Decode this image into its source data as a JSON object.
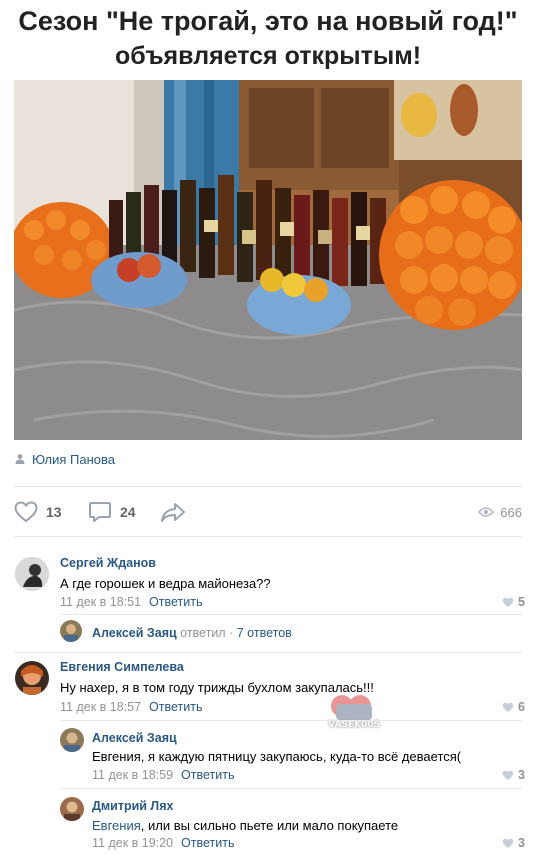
{
  "meme": {
    "line1": "Сезон \"Не трогай, это на новый год!\"",
    "line2": "объявляется открытым!"
  },
  "post": {
    "author": "Юлия Панова",
    "likes": "13",
    "comments": "24",
    "views": "666"
  },
  "comments": [
    {
      "name": "Сергей Жданов",
      "text": "А где горошек и ведра майонеза??",
      "date": "11 дек в 18:51",
      "reply_label": "Ответить",
      "likes": "5"
    },
    {
      "name": "Евгения Симпелева",
      "text": "Ну нахер, я в том году трижды бухлом закупалась!!!",
      "date": "11 дек в 18:57",
      "reply_label": "Ответить",
      "likes": "6"
    }
  ],
  "thread": {
    "name": "Алексей Заяц",
    "replied": "ответил",
    "sep": "·",
    "count_label": "7 ответов"
  },
  "replies": [
    {
      "name": "Алексей Заяц",
      "text": "Евгения, я каждую пятницу закупаюсь, куда-то всё девается(",
      "date": "11 дек в 18:59",
      "reply_label": "Ответить",
      "likes": "3"
    },
    {
      "name": "Дмитрий Лях",
      "addressee": "Евгения",
      "text": ", или вы сильно пьете или мало покупаете",
      "date": "11 дек в 19:20",
      "reply_label": "Ответить",
      "likes": "3"
    }
  ],
  "watermark": {
    "text": "VASEK005"
  },
  "icons": {
    "author": "person-icon",
    "like": "heart-icon",
    "comment": "comment-bubble-icon",
    "share": "share-arrow-icon",
    "views": "eye-icon"
  },
  "colors": {
    "link": "#2a5885",
    "muted": "#939393",
    "divider": "#e7e8ec"
  }
}
